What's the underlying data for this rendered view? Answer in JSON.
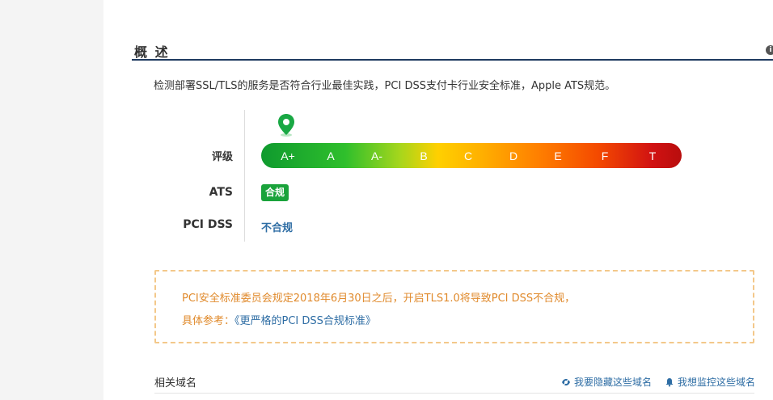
{
  "overview": {
    "title": "概 述",
    "info_icon": "info-icon",
    "description": "检测部署SSL/TLS的服务是否符合行业最佳实践，PCI DSS支付卡行业安全标准，Apple ATS规范。"
  },
  "rating": {
    "label": "评级",
    "current_grade": "A+",
    "grades": [
      "A+",
      "A",
      "A-",
      "B",
      "C",
      "D",
      "E",
      "F",
      "T"
    ],
    "marker_icon": "map-pin-icon",
    "colors": {
      "start": "#0f9a2e",
      "middle": "#ffd000",
      "end": "#b80d0d"
    }
  },
  "ats": {
    "label": "ATS",
    "status": "合规",
    "color": "#1aa33b"
  },
  "pci": {
    "label": "PCI DSS",
    "status": "不合规",
    "color": "#2e6da4"
  },
  "notice": {
    "line1": "PCI安全标准委员会规定2018年6月30日之后，开启TLS1.0将导致PCI DSS不合规，",
    "ref_prefix": "具体参考：",
    "ref_link": "《更严格的PCI DSS合规标准》",
    "text_color": "#e08a2c"
  },
  "related": {
    "title": "相关域名",
    "hide_action": "我要隐藏这些域名",
    "hide_icon": "eye-icon",
    "monitor_action": "我想监控这些域名",
    "monitor_icon": "bell-icon"
  }
}
